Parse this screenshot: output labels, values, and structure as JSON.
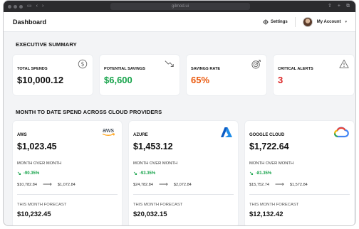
{
  "browser": {
    "url": "gilmod.ui"
  },
  "header": {
    "title": "Dashboard",
    "settings_label": "Settings",
    "account_label": "My Account"
  },
  "summary": {
    "title": "EXECUTIVE SUMMARY",
    "cards": [
      {
        "label": "TOTAL SPENDS",
        "value": "$10,000.12",
        "color": "#111111",
        "icon": "dollar-circle-icon"
      },
      {
        "label": "POTENTIAL SAVINGS",
        "value": "$6,600",
        "color": "#16a34a",
        "icon": "trend-down-icon"
      },
      {
        "label": "SAVINGS RATE",
        "value": "65%",
        "color": "#ea580c",
        "icon": "target-icon"
      },
      {
        "label": "CRITICAL ALERTS",
        "value": "3",
        "color": "#dc2626",
        "icon": "warning-icon"
      }
    ]
  },
  "providers": {
    "title": "MONTH TO DATE SPEND ACROSS CLOUD PROVIDERS",
    "cards": [
      {
        "name": "AWS",
        "value": "$1,023.45",
        "mom_label": "MONTH OVER MONTH",
        "change": "-90.35%",
        "from": "$10,782.84",
        "to": "$1,072.84",
        "forecast_label": "THIS MONTH FORECAST",
        "forecast": "$10,232.45",
        "logo_text": "aws"
      },
      {
        "name": "AZURE",
        "value": "$1,453.12",
        "mom_label": "MONTH OVER MONTH",
        "change": "-93.35%",
        "from": "$24,782.84",
        "to": "$2,072.84",
        "forecast_label": "THIS MONTH FORECAST",
        "forecast": "$20,032.15"
      },
      {
        "name": "GOOGLE CLOUD",
        "value": "$1,722.64",
        "mom_label": "MONTH OVER MONTH",
        "change": "-81.35%",
        "from": "$15,752.74",
        "to": "$1,572.84",
        "forecast_label": "THIS MONTH FORECAST",
        "forecast": "$12,132.42"
      }
    ]
  }
}
